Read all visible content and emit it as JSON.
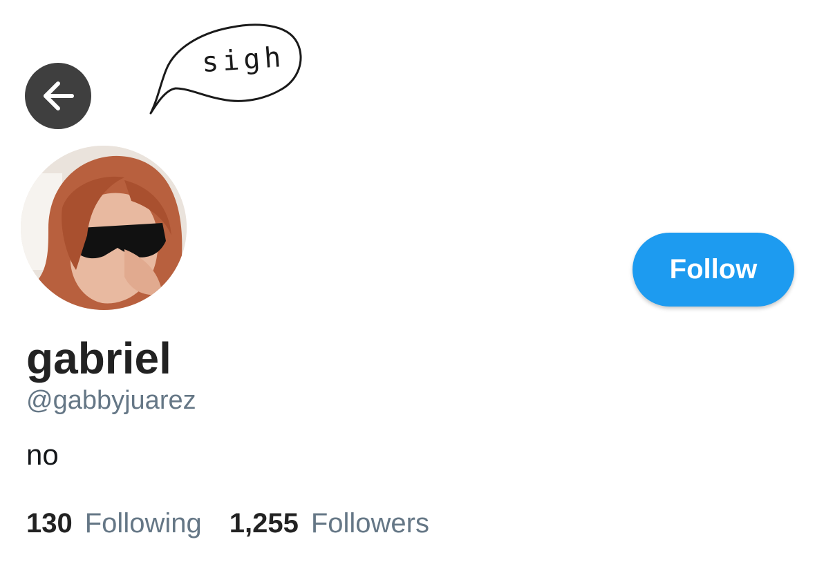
{
  "header": {
    "back_icon": "arrow-left-icon",
    "speech_bubble_text": "sigh"
  },
  "profile": {
    "display_name": "gabriel",
    "handle": "@gabbyjuarez",
    "bio": "no",
    "follow_label": "Follow",
    "stats": {
      "following_count": "130",
      "following_label": "Following",
      "followers_count": "1,255",
      "followers_label": "Followers"
    }
  },
  "colors": {
    "accent": "#1d9bf0",
    "back_button_bg": "#3f3f3f",
    "secondary_text": "#657786",
    "primary_text": "#222222"
  }
}
